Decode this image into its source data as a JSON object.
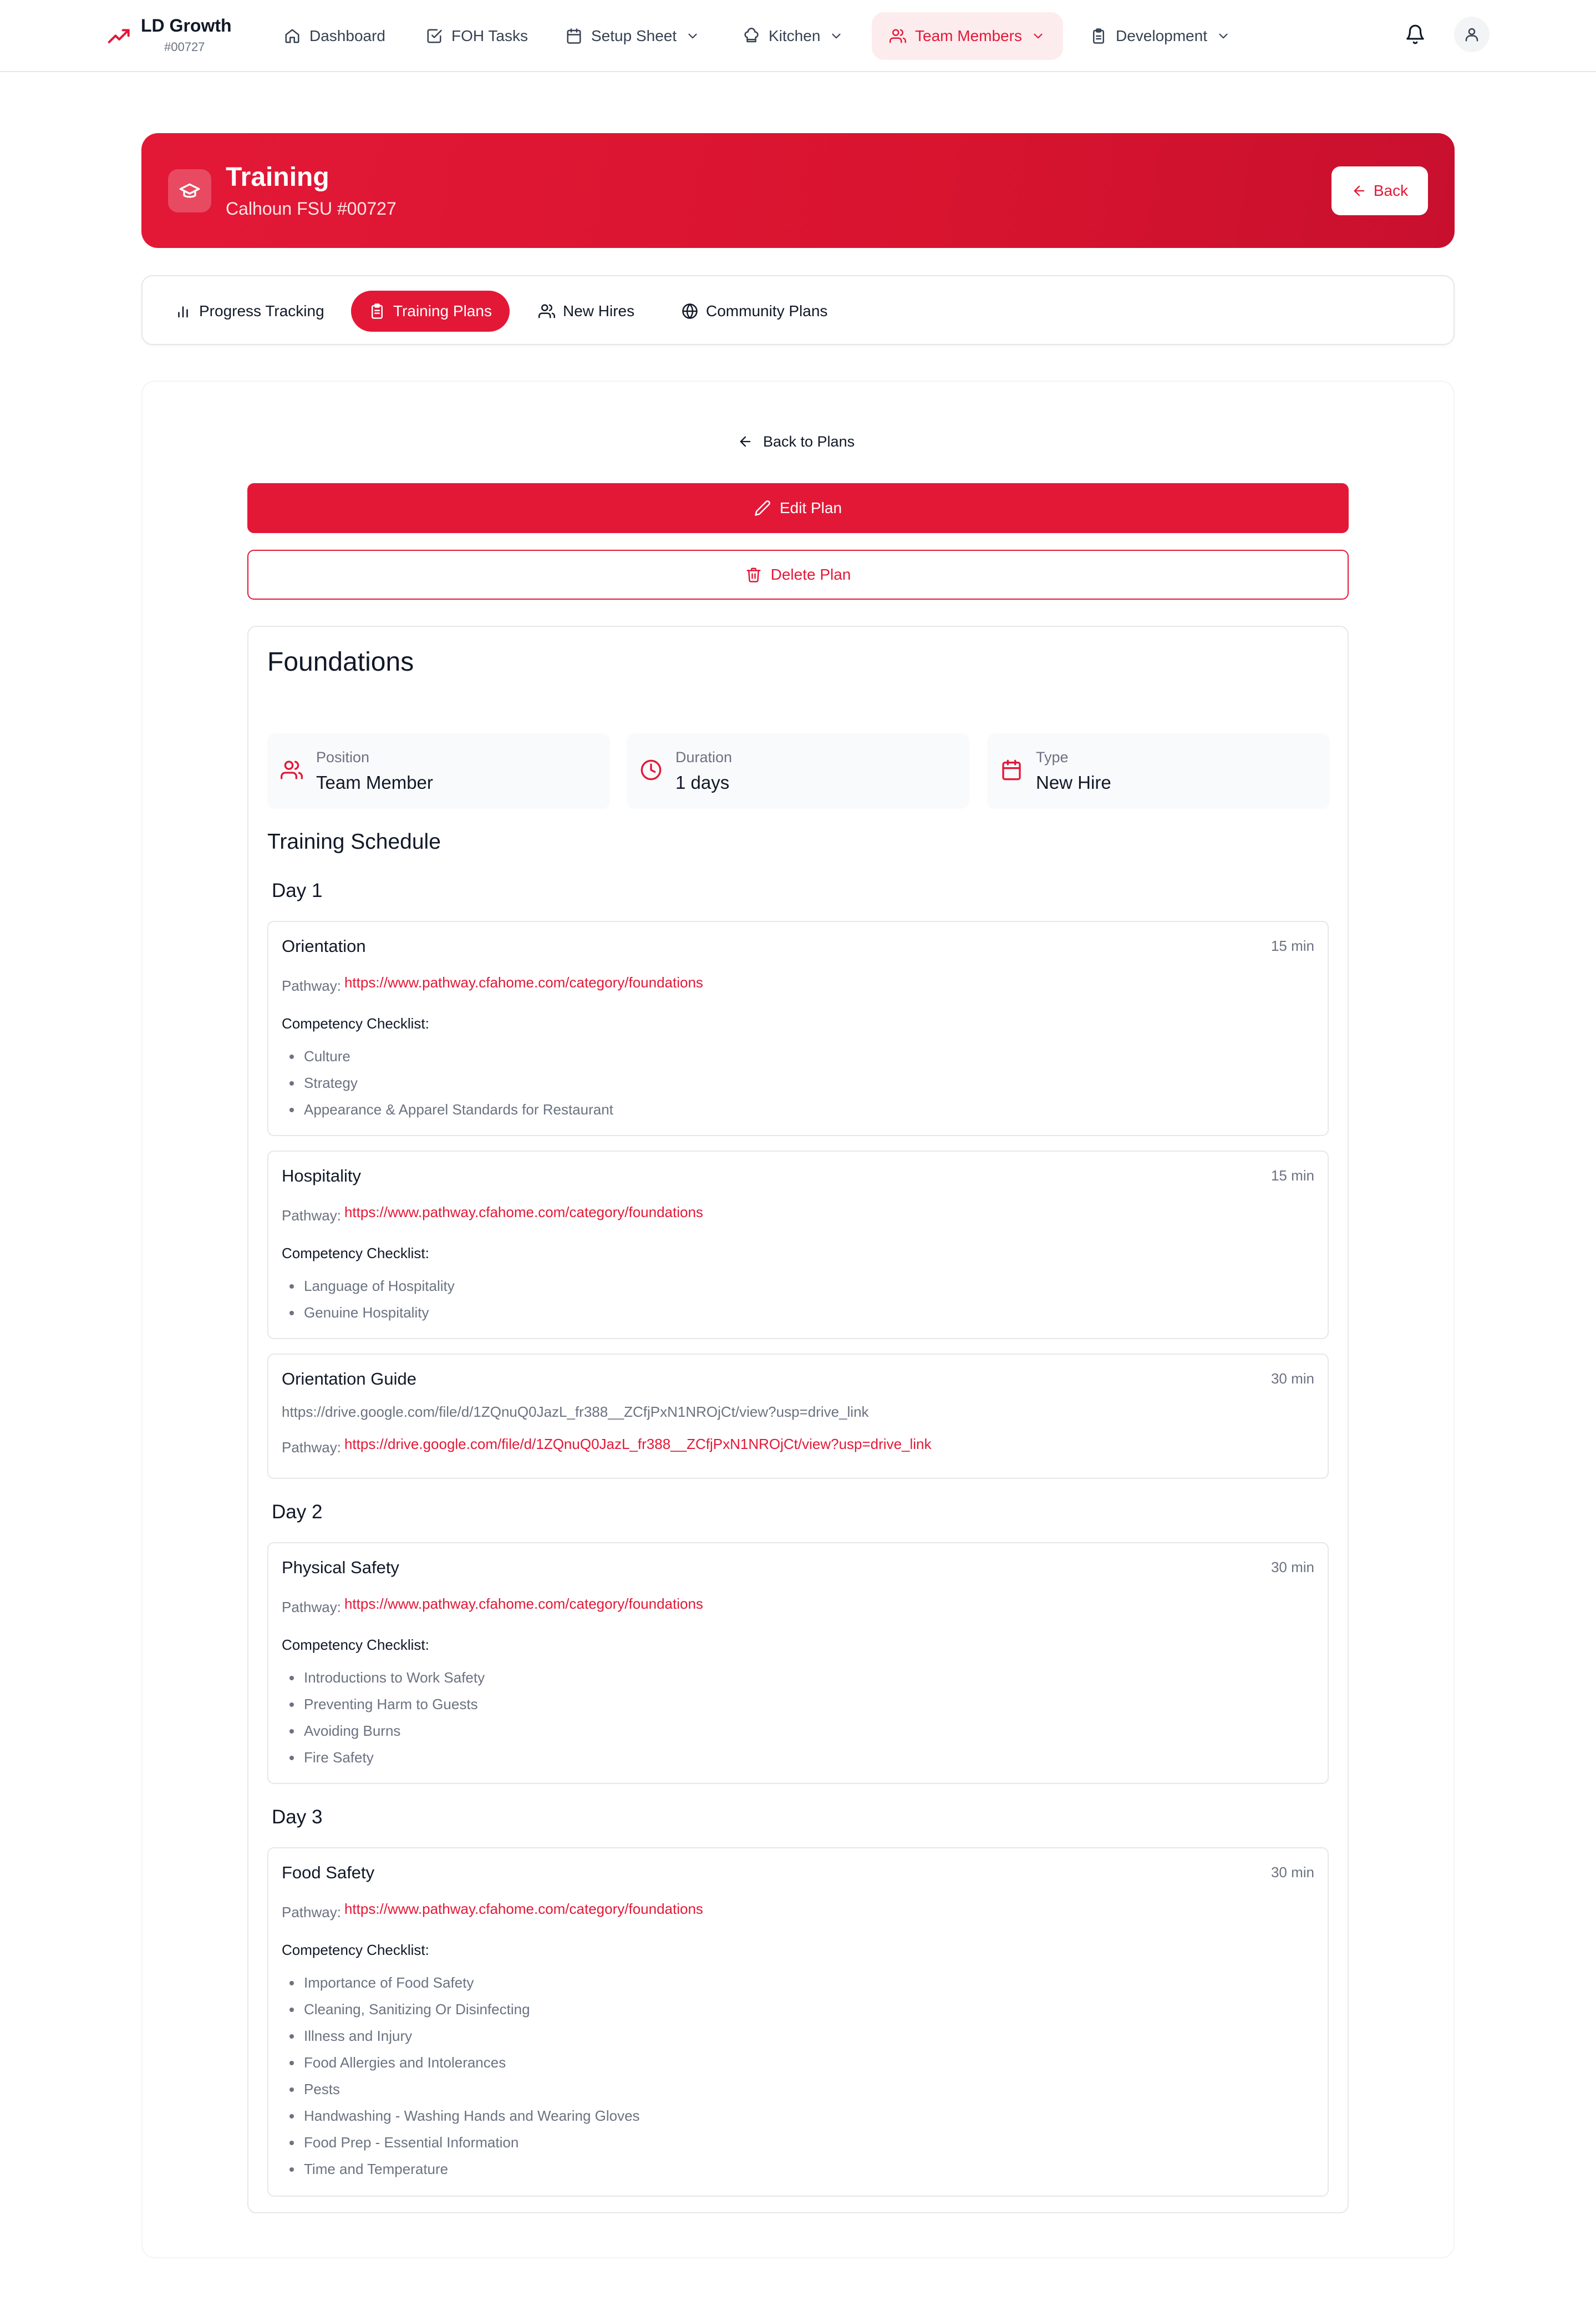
{
  "nav": {
    "brand_name": "LD Growth",
    "brand_id": "#00727",
    "items": [
      {
        "label": "Dashboard",
        "icon": "home-icon"
      },
      {
        "label": "FOH Tasks",
        "icon": "checkbox-icon"
      },
      {
        "label": "Setup Sheet",
        "icon": "calendar-icon",
        "dropdown": true
      },
      {
        "label": "Kitchen",
        "icon": "chef-hat-icon",
        "dropdown": true
      },
      {
        "label": "Team Members",
        "icon": "users-icon",
        "dropdown": true,
        "active": true
      },
      {
        "label": "Development",
        "icon": "clipboard-icon",
        "dropdown": true
      }
    ]
  },
  "header": {
    "title": "Training",
    "subtitle": "Calhoun FSU #00727",
    "back_label": "Back"
  },
  "tabs": [
    {
      "label": "Progress Tracking",
      "icon": "bar-chart-icon"
    },
    {
      "label": "Training Plans",
      "icon": "clipboard-list-icon",
      "active": true
    },
    {
      "label": "New Hires",
      "icon": "users-icon"
    },
    {
      "label": "Community Plans",
      "icon": "globe-icon"
    }
  ],
  "actions": {
    "back_to_plans": "Back to Plans",
    "edit_plan": "Edit Plan",
    "delete_plan": "Delete Plan"
  },
  "plan": {
    "title": "Foundations",
    "meta": [
      {
        "label": "Position",
        "value": "Team Member",
        "icon": "users-icon"
      },
      {
        "label": "Duration",
        "value": "1 days",
        "icon": "clock-icon"
      },
      {
        "label": "Type",
        "value": "New Hire",
        "icon": "calendar-icon"
      }
    ],
    "schedule_title": "Training Schedule",
    "pathway_label": "Pathway:",
    "competency_label": "Competency Checklist:",
    "days": [
      {
        "label": "Day 1",
        "items": [
          {
            "name": "Orientation",
            "duration": "15 min",
            "pathway": "https://www.pathway.cfahome.com/category/foundations",
            "competencies": [
              "Culture",
              "Strategy",
              "Appearance & Apparel Standards for Restaurant"
            ]
          },
          {
            "name": "Hospitality",
            "duration": "15 min",
            "pathway": "https://www.pathway.cfahome.com/category/foundations",
            "competencies": [
              "Language of Hospitality",
              "Genuine Hospitality"
            ]
          },
          {
            "name": "Orientation Guide",
            "duration": "30 min",
            "description": "https://drive.google.com/file/d/1ZQnuQ0JazL_fr388__ZCfjPxN1NROjCt/view?usp=drive_link",
            "pathway": "https://drive.google.com/file/d/1ZQnuQ0JazL_fr388__ZCfjPxN1NROjCt/view?usp=drive_link",
            "competencies": []
          }
        ]
      },
      {
        "label": "Day 2",
        "items": [
          {
            "name": "Physical Safety",
            "duration": "30 min",
            "pathway": "https://www.pathway.cfahome.com/category/foundations",
            "competencies": [
              "Introductions to Work Safety",
              "Preventing Harm to Guests",
              "Avoiding Burns",
              "Fire Safety"
            ]
          }
        ]
      },
      {
        "label": "Day 3",
        "items": [
          {
            "name": "Food Safety",
            "duration": "30 min",
            "pathway": "https://www.pathway.cfahome.com/category/foundations",
            "competencies": [
              "Importance of Food Safety",
              "Cleaning, Sanitizing Or Disinfecting",
              "Illness and Injury",
              "Food Allergies and Intolerances",
              "Pests",
              "Handwashing - Washing Hands and Wearing Gloves",
              "Food Prep - Essential Information",
              "Time and Temperature"
            ]
          }
        ]
      }
    ]
  },
  "colors": {
    "brand_red": "#e31837",
    "active_nav_bg": "#fdecee",
    "muted_text": "#6b7280"
  }
}
